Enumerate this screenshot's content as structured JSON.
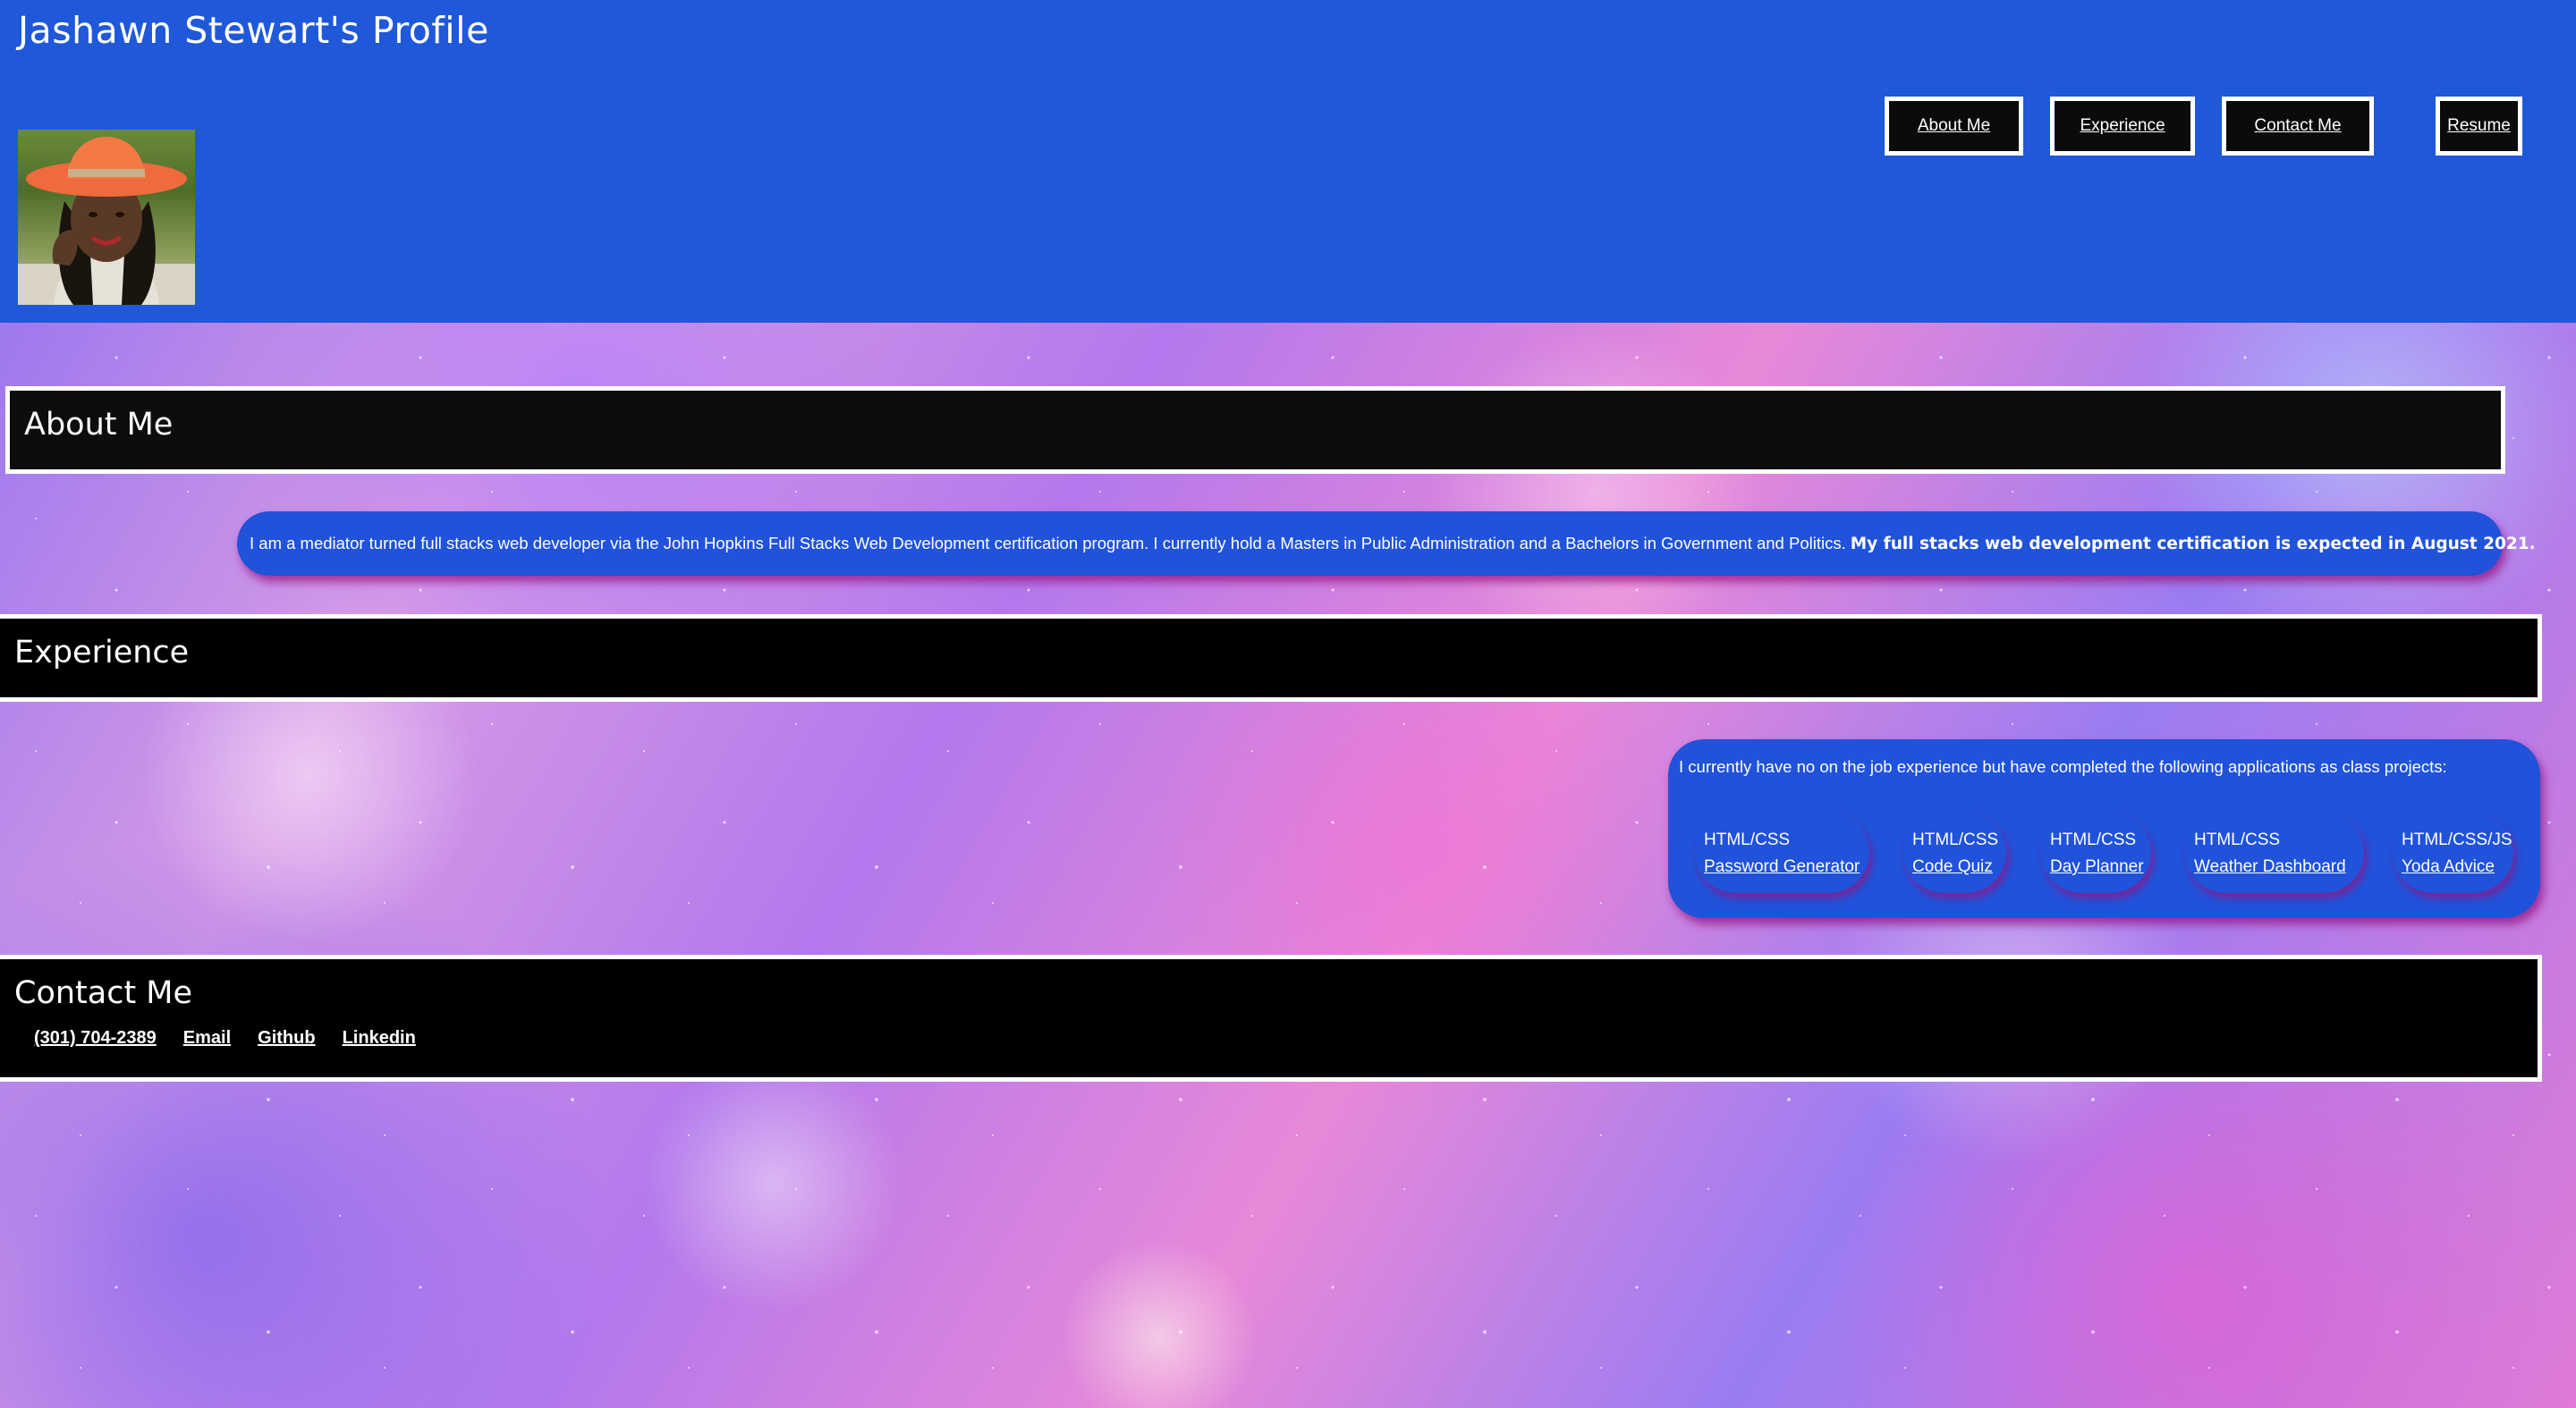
{
  "header": {
    "title": "Jashawn Stewart's Profile",
    "nav": [
      {
        "label": "About Me"
      },
      {
        "label": "Experience"
      },
      {
        "label": "Contact Me"
      },
      {
        "label": "Resume"
      }
    ]
  },
  "about": {
    "heading": "About Me",
    "text": "I am a mediator turned full stacks web developer via the John Hopkins Full Stacks Web Development certification program. I currently hold a Masters in Public Administration and a Bachelors in Government and Politics.",
    "emphasis": "My full stacks web development certification is expected in August 2021."
  },
  "experience": {
    "heading": "Experience",
    "intro": "I currently have no on the job experience but have completed the following applications as class projects:",
    "projects": [
      {
        "tech": "HTML/CSS",
        "name": "Password Generator"
      },
      {
        "tech": "HTML/CSS",
        "name": "Code Quiz"
      },
      {
        "tech": "HTML/CSS",
        "name": "Day Planner"
      },
      {
        "tech": "HTML/CSS",
        "name": "Weather Dashboard"
      },
      {
        "tech": "HTML/CSS/JS",
        "name": "Yoda Advice"
      }
    ]
  },
  "contact": {
    "heading": "Contact Me",
    "links": [
      {
        "label": "(301) 704-2389"
      },
      {
        "label": "Email"
      },
      {
        "label": "Github"
      },
      {
        "label": "Linkedin"
      }
    ]
  },
  "colors": {
    "header_bg": "#1f58d9",
    "section_bg": "#000000",
    "pill_bg": "#2052da",
    "pill_shadow": "#96148a"
  }
}
